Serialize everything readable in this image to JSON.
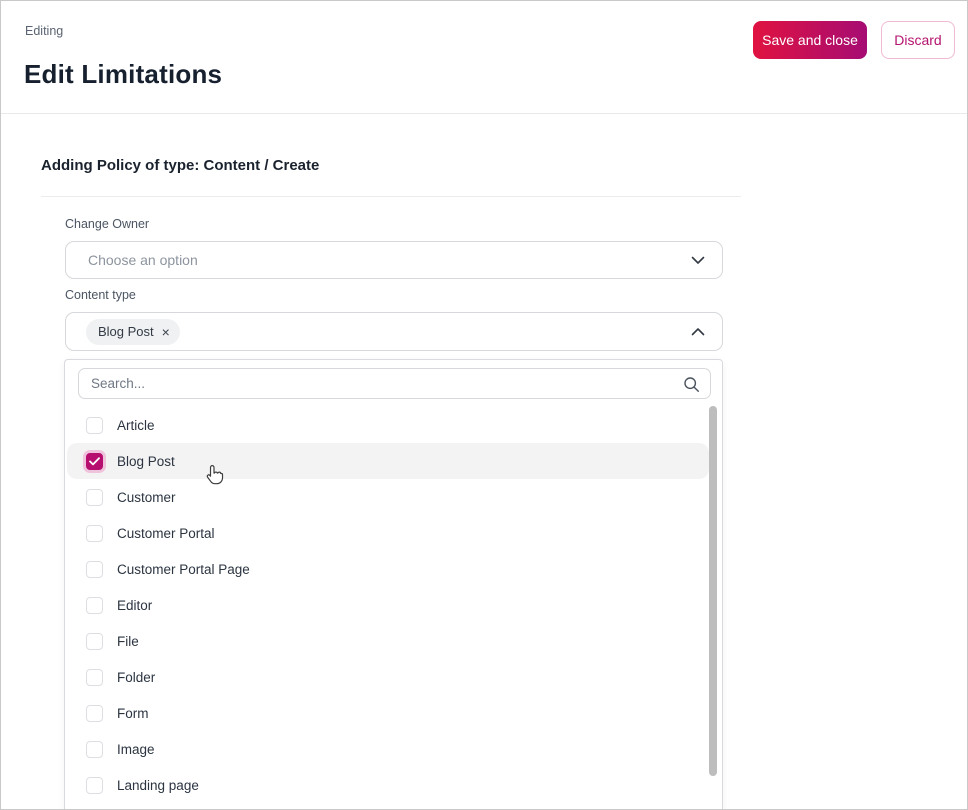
{
  "header": {
    "breadcrumb": "Editing",
    "title": "Edit Limitations",
    "save_label": "Save and close",
    "discard_label": "Discard"
  },
  "section": {
    "title": "Adding Policy of type: Content / Create"
  },
  "fields": {
    "change_owner": {
      "label": "Change Owner",
      "placeholder": "Choose an option"
    },
    "content_type": {
      "label": "Content type",
      "chip": "Blog Post"
    }
  },
  "dropdown": {
    "search_placeholder": "Search...",
    "options": [
      {
        "label": "Article",
        "checked": false,
        "highlighted": false
      },
      {
        "label": "Blog Post",
        "checked": true,
        "highlighted": true
      },
      {
        "label": "Customer",
        "checked": false,
        "highlighted": false
      },
      {
        "label": "Customer Portal",
        "checked": false,
        "highlighted": false
      },
      {
        "label": "Customer Portal Page",
        "checked": false,
        "highlighted": false
      },
      {
        "label": "Editor",
        "checked": false,
        "highlighted": false
      },
      {
        "label": "File",
        "checked": false,
        "highlighted": false
      },
      {
        "label": "Folder",
        "checked": false,
        "highlighted": false
      },
      {
        "label": "Form",
        "checked": false,
        "highlighted": false
      },
      {
        "label": "Image",
        "checked": false,
        "highlighted": false
      },
      {
        "label": "Landing page",
        "checked": false,
        "highlighted": false
      }
    ]
  },
  "icons": {
    "chip_remove": "×"
  },
  "colors": {
    "accent_gradient_start": "#e01240",
    "accent_gradient_end": "#a60c73",
    "accent_text": "#b5146f",
    "checkbox_checked": "#b60f6f",
    "row_highlight": "#f3f3f4"
  }
}
